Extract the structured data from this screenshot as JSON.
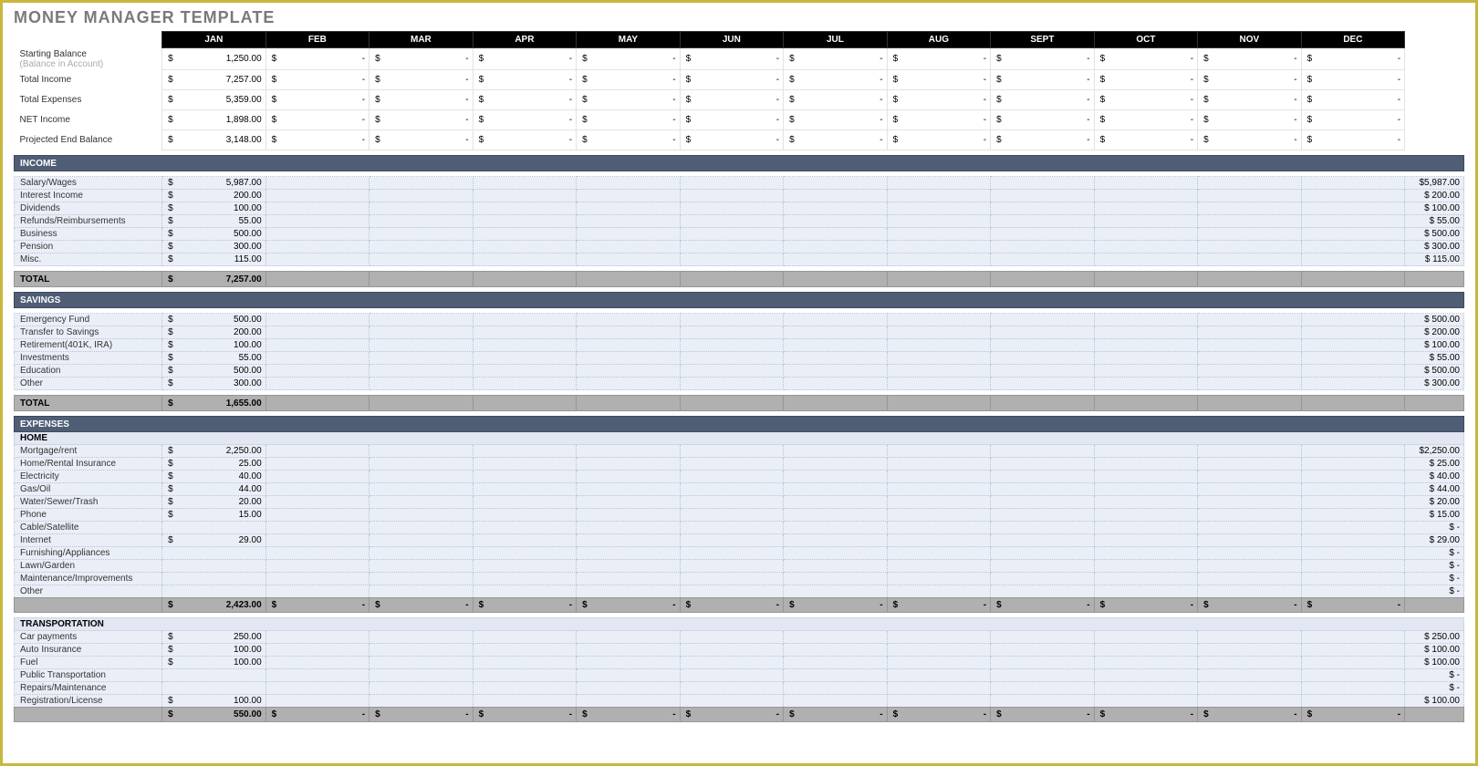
{
  "title": "MONEY MANAGER TEMPLATE",
  "months": [
    "JAN",
    "FEB",
    "MAR",
    "APR",
    "MAY",
    "JUN",
    "JUL",
    "AUG",
    "SEPT",
    "OCT",
    "NOV",
    "DEC"
  ],
  "summary": [
    {
      "label": "Starting Balance",
      "sublabel": "(Balance in Account)",
      "jan": "1,250.00"
    },
    {
      "label": "Total Income",
      "jan": "7,257.00"
    },
    {
      "label": "Total Expenses",
      "jan": "5,359.00"
    },
    {
      "label": "NET Income",
      "jan": "1,898.00"
    },
    {
      "label": "Projected End Balance",
      "jan": "3,148.00"
    }
  ],
  "sections": [
    {
      "name": "INCOME",
      "rows": [
        {
          "label": "Salary/Wages",
          "jan": "5,987.00",
          "tot": "$5,987.00"
        },
        {
          "label": "Interest Income",
          "jan": "200.00",
          "tot": "$  200.00"
        },
        {
          "label": "Dividends",
          "jan": "100.00",
          "tot": "$  100.00"
        },
        {
          "label": "Refunds/Reimbursements",
          "jan": "55.00",
          "tot": "$    55.00"
        },
        {
          "label": "Business",
          "jan": "500.00",
          "tot": "$  500.00"
        },
        {
          "label": "Pension",
          "jan": "300.00",
          "tot": "$  300.00"
        },
        {
          "label": "Misc.",
          "jan": "115.00",
          "tot": "$  115.00"
        }
      ],
      "total_label": "TOTAL",
      "total_jan": "7,257.00"
    },
    {
      "name": "SAVINGS",
      "rows": [
        {
          "label": "Emergency Fund",
          "jan": "500.00",
          "tot": "$  500.00"
        },
        {
          "label": "Transfer to Savings",
          "jan": "200.00",
          "tot": "$  200.00"
        },
        {
          "label": "Retirement(401K, IRA)",
          "jan": "100.00",
          "tot": "$  100.00"
        },
        {
          "label": "Investments",
          "jan": "55.00",
          "tot": "$    55.00"
        },
        {
          "label": "Education",
          "jan": "500.00",
          "tot": "$  500.00"
        },
        {
          "label": "Other",
          "jan": "300.00",
          "tot": "$  300.00"
        }
      ],
      "total_label": "TOTAL",
      "total_jan": "1,655.00"
    }
  ],
  "expenses": {
    "name": "EXPENSES",
    "groups": [
      {
        "name": "HOME",
        "rows": [
          {
            "label": "Mortgage/rent",
            "jan": "2,250.00",
            "tot": "$2,250.00"
          },
          {
            "label": "Home/Rental Insurance",
            "jan": "25.00",
            "tot": "$    25.00"
          },
          {
            "label": "Electricity",
            "jan": "40.00",
            "tot": "$    40.00"
          },
          {
            "label": "Gas/Oil",
            "jan": "44.00",
            "tot": "$    44.00"
          },
          {
            "label": "Water/Sewer/Trash",
            "jan": "20.00",
            "tot": "$    20.00"
          },
          {
            "label": "Phone",
            "jan": "15.00",
            "tot": "$    15.00"
          },
          {
            "label": "Cable/Satellite",
            "jan": "",
            "tot": "$        -"
          },
          {
            "label": "Internet",
            "jan": "29.00",
            "tot": "$    29.00"
          },
          {
            "label": "Furnishing/Appliances",
            "jan": "",
            "tot": "$        -"
          },
          {
            "label": "Lawn/Garden",
            "jan": "",
            "tot": "$        -"
          },
          {
            "label": "Maintenance/Improvements",
            "jan": "",
            "tot": "$        -"
          },
          {
            "label": "Other",
            "jan": "",
            "tot": "$        -"
          }
        ],
        "subtotal_jan": "2,423.00"
      },
      {
        "name": "TRANSPORTATION",
        "rows": [
          {
            "label": "Car payments",
            "jan": "250.00",
            "tot": "$  250.00"
          },
          {
            "label": "Auto Insurance",
            "jan": "100.00",
            "tot": "$  100.00"
          },
          {
            "label": "Fuel",
            "jan": "100.00",
            "tot": "$  100.00"
          },
          {
            "label": "Public Transportation",
            "jan": "",
            "tot": "$        -"
          },
          {
            "label": "Repairs/Maintenance",
            "jan": "",
            "tot": "$        -"
          },
          {
            "label": "Registration/License",
            "jan": "100.00",
            "tot": "$  100.00"
          }
        ],
        "subtotal_jan": "550.00"
      }
    ]
  },
  "dash": "-",
  "sym": "$"
}
